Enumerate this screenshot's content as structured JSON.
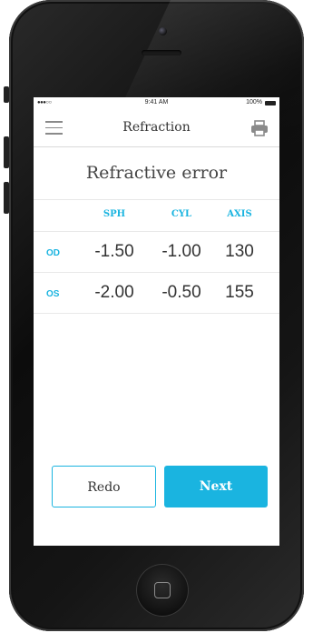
{
  "status_bar": {
    "signal": "●●●○○",
    "time": "9:41 AM",
    "battery": "100%"
  },
  "nav": {
    "title": "Refraction",
    "menu_icon": "hamburger-menu-icon",
    "print_icon": "printer-icon"
  },
  "section_title": "Refractive error",
  "table": {
    "columns": [
      "SPH",
      "CYL",
      "AXIS"
    ],
    "rows": [
      {
        "label": "OD",
        "sph": "-1.50",
        "cyl": "-1.00",
        "axis": "130"
      },
      {
        "label": "OS",
        "sph": "-2.00",
        "cyl": "-0.50",
        "axis": "155"
      }
    ]
  },
  "buttons": {
    "redo": "Redo",
    "next": "Next"
  },
  "colors": {
    "accent": "#1ab4e0",
    "text": "#333333"
  }
}
